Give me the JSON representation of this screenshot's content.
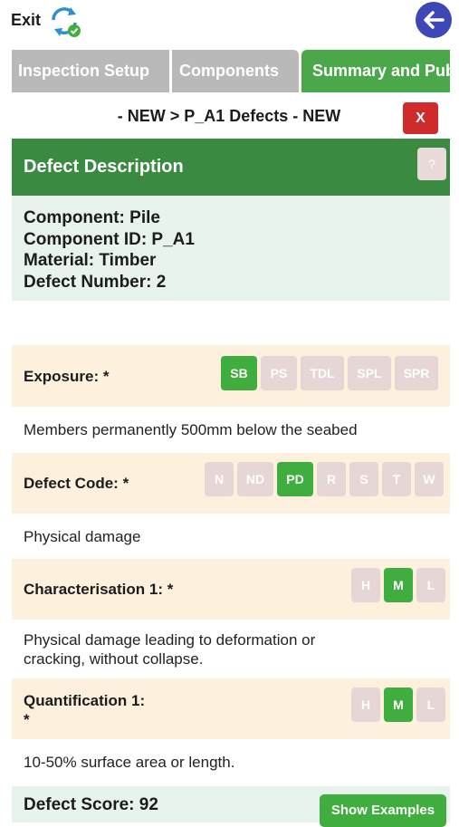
{
  "topbar": {
    "exit_label": "Exit"
  },
  "tabs": [
    {
      "label": "Inspection Setup"
    },
    {
      "label": "Components"
    },
    {
      "label": "Summary and Publish"
    }
  ],
  "breadcrumb": "- NEW > P_A1 Defects - NEW",
  "close_label": "X",
  "defect_header": {
    "title": "Defect Description",
    "help_label": "?"
  },
  "info": {
    "component": "Component: Pile",
    "component_id": "Component ID: P_A1",
    "material": "Material: Timber",
    "defect_number": "Defect Number: 2"
  },
  "exposure": {
    "label": "Exposure: *",
    "options": [
      "SB",
      "PS",
      "TDL",
      "SPL",
      "SPR"
    ],
    "selected": "SB",
    "description": "Members permanently 500mm below the seabed"
  },
  "defect_code": {
    "label": "Defect Code: *",
    "options": [
      "N",
      "ND",
      "PD",
      "R",
      "S",
      "T",
      "W"
    ],
    "selected": "PD",
    "description": "Physical damage"
  },
  "characterisation": {
    "label": "Characterisation 1: *",
    "options": [
      "H",
      "M",
      "L"
    ],
    "selected": "M",
    "description_line1": "Physical damage leading to deformation or",
    "description_line2": "cracking, without collapse."
  },
  "quantification": {
    "label_line1": "Quantification 1:",
    "label_line2": "*",
    "options": [
      "H",
      "M",
      "L"
    ],
    "selected": "M",
    "description": "10-50% surface area or length."
  },
  "score": {
    "text": "Defect Score: 92",
    "examples_label": "Show Examples"
  },
  "colors": {
    "accent_green": "#3fae3f",
    "header_green": "#3a8a42",
    "back_blue": "#3d47b6",
    "close_red": "#d02b2b"
  }
}
